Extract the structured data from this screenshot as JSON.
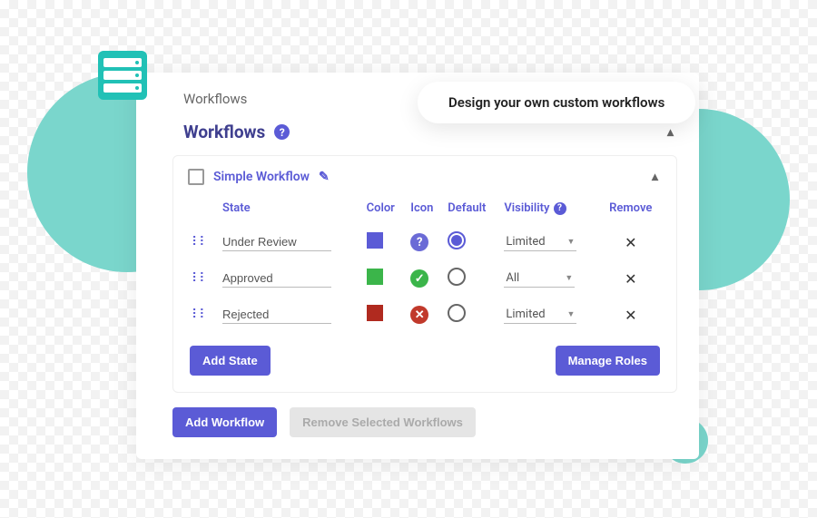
{
  "callout": "Design your own custom workflows",
  "page_title": "Workflows",
  "section_title": "Workflows",
  "workflow": {
    "name": "Simple Workflow",
    "columns": {
      "state": "State",
      "color": "Color",
      "icon": "Icon",
      "default": "Default",
      "visibility": "Visibility",
      "remove": "Remove"
    },
    "rows": [
      {
        "state": "Under Review",
        "color": "#5b5bd6",
        "icon": "help",
        "default": true,
        "visibility": "Limited"
      },
      {
        "state": "Approved",
        "color": "#3bb54a",
        "icon": "check",
        "default": false,
        "visibility": "All"
      },
      {
        "state": "Rejected",
        "color": "#b02a1f",
        "icon": "x",
        "default": false,
        "visibility": "Limited"
      }
    ],
    "add_state_label": "Add State",
    "manage_roles_label": "Manage Roles"
  },
  "add_workflow_label": "Add Workflow",
  "remove_workflows_label": "Remove Selected Workflows"
}
